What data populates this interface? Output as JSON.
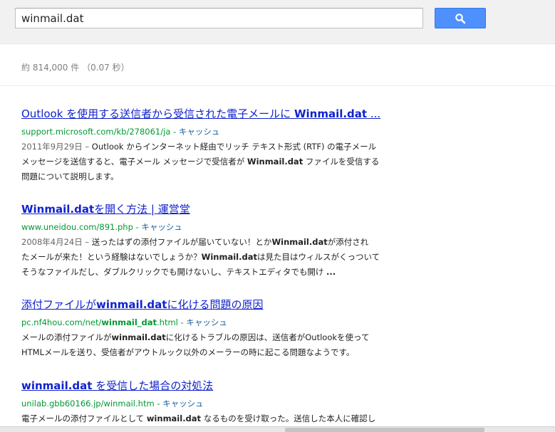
{
  "search": {
    "query": "winmail.dat",
    "button_icon": "search-icon"
  },
  "stats": "約 814,000 件 （0.07 秒）",
  "results": [
    {
      "title": [
        {
          "t": "Outlook を使用する送信者から受信された電子メールに ",
          "b": false
        },
        {
          "t": "Winmail.dat",
          "b": true
        },
        {
          "t": " ...",
          "b": false
        }
      ],
      "url": [
        {
          "t": "support.microsoft.com/kb/278061/ja",
          "b": false
        }
      ],
      "cache": "キャッシュ",
      "snippet_lines": [
        [
          {
            "t": "2011年9月29日 – ",
            "b": false,
            "d": true
          },
          {
            "t": "Outlook からインターネット経由でリッチ テキスト形式 (RTF) の電子メール",
            "b": false
          }
        ],
        [
          {
            "t": "メッセージを送信すると、電子メール メッセージで受信者が ",
            "b": false
          },
          {
            "t": "Winmail.dat",
            "b": true
          },
          {
            "t": " ファイルを受信する",
            "b": false
          }
        ],
        [
          {
            "t": "問題について説明します。",
            "b": false
          }
        ]
      ]
    },
    {
      "title": [
        {
          "t": "Winmail.dat",
          "b": true
        },
        {
          "t": "を開く方法 | 運営堂",
          "b": false
        }
      ],
      "url": [
        {
          "t": "www.uneidou.com/891.php",
          "b": false
        }
      ],
      "cache": "キャッシュ",
      "snippet_lines": [
        [
          {
            "t": "2008年4月24日 – ",
            "b": false,
            "d": true
          },
          {
            "t": "送ったはずの添付ファイルが届いていない！とか",
            "b": false
          },
          {
            "t": "Winmail.dat",
            "b": true
          },
          {
            "t": "が添付され",
            "b": false
          }
        ],
        [
          {
            "t": "たメールが来た！という経験はないでしょうか？",
            "b": false
          },
          {
            "t": "Winmail.dat",
            "b": true
          },
          {
            "t": "は見た目はウィルスがくっついて",
            "b": false
          }
        ],
        [
          {
            "t": "そうなファイルだし、ダブルクリックでも開けないし、テキストエディタでも開け ",
            "b": false
          },
          {
            "t": "...",
            "b": true
          }
        ]
      ]
    },
    {
      "title": [
        {
          "t": "添付ファイルが",
          "b": false
        },
        {
          "t": "winmail.dat",
          "b": true
        },
        {
          "t": "に化ける問題の原因",
          "b": false
        }
      ],
      "url": [
        {
          "t": "pc.nf4hou.com/net/",
          "b": false
        },
        {
          "t": "winmail_dat",
          "b": true
        },
        {
          "t": ".html",
          "b": false
        }
      ],
      "cache": "キャッシュ",
      "snippet_lines": [
        [
          {
            "t": "メールの添付ファイルが",
            "b": false
          },
          {
            "t": "winmail.dat",
            "b": true
          },
          {
            "t": "に化けるトラブルの原因は、送信者がOutlookを使って",
            "b": false
          }
        ],
        [
          {
            "t": "HTMLメールを送り、受信者がアウトルック以外のメーラーの時に起こる問題なようです。",
            "b": false
          }
        ]
      ]
    },
    {
      "title": [
        {
          "t": "winmail.dat",
          "b": true
        },
        {
          "t": " を受信した場合の対処法",
          "b": false
        }
      ],
      "url": [
        {
          "t": "unilab.gbb60166.jp/winmail.htm",
          "b": false
        }
      ],
      "cache": "キャッシュ",
      "snippet_lines": [
        [
          {
            "t": "電子メールの添付ファイルとして ",
            "b": false
          },
          {
            "t": "winmail.dat",
            "b": true
          },
          {
            "t": " なるものを受け取った。送信した本人に確認し",
            "b": false
          }
        ]
      ]
    }
  ]
}
